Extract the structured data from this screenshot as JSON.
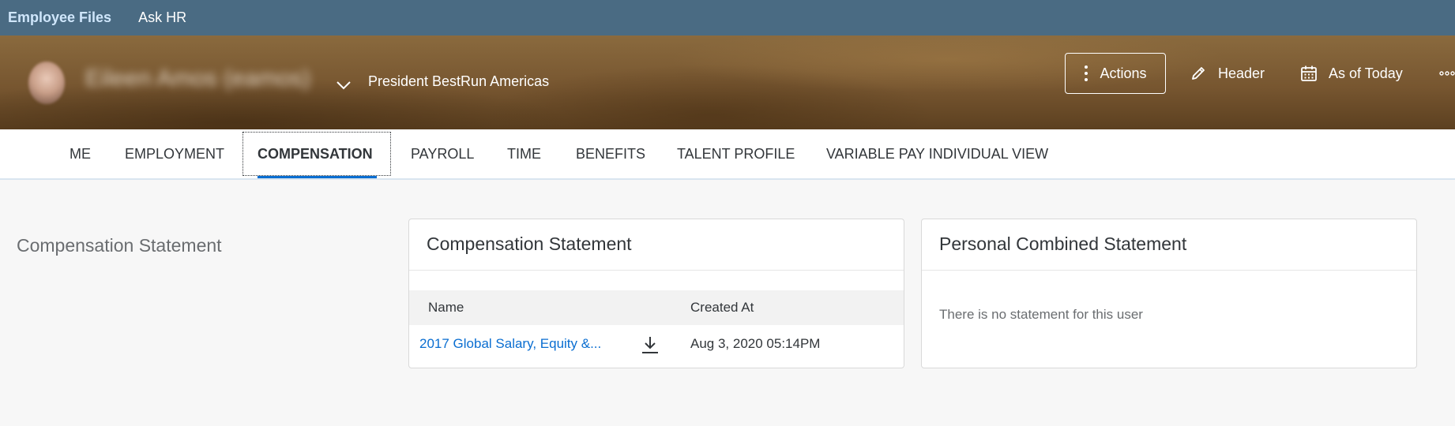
{
  "topbar": {
    "items": [
      {
        "label": "Employee Files",
        "active": true
      },
      {
        "label": "Ask HR",
        "active": false
      }
    ]
  },
  "header": {
    "person_name": "Eileen Amos (eamos)",
    "job_title": "President BestRun Americas",
    "buttons": {
      "actions": "Actions",
      "header": "Header",
      "as_of": "As of Today"
    },
    "icons": {
      "actions": "vertical-dots-icon",
      "header": "pencil-icon",
      "as_of": "calendar-icon",
      "more": "horizontal-dots-icon",
      "name_toggle": "chevron-down-icon"
    }
  },
  "tabs": [
    {
      "label": "ME"
    },
    {
      "label": "EMPLOYMENT"
    },
    {
      "label": "COMPENSATION",
      "selected": true
    },
    {
      "label": "PAYROLL"
    },
    {
      "label": "TIME"
    },
    {
      "label": "BENEFITS"
    },
    {
      "label": "TALENT PROFILE"
    },
    {
      "label": "VARIABLE PAY INDIVIDUAL VIEW"
    }
  ],
  "section": {
    "label": "Compensation Statement"
  },
  "compensation_card": {
    "title": "Compensation Statement",
    "columns": [
      "Name",
      "Created At"
    ],
    "rows": [
      {
        "name": "2017 Global Salary, Equity &...",
        "created_at": "Aug 3, 2020 05:14PM"
      }
    ]
  },
  "combined_card": {
    "title": "Personal Combined Statement",
    "empty_message": "There is no statement for this user"
  },
  "colors": {
    "topbar": "#4a6b83",
    "accent": "#0a6ed1",
    "link": "#0a6ed1"
  }
}
